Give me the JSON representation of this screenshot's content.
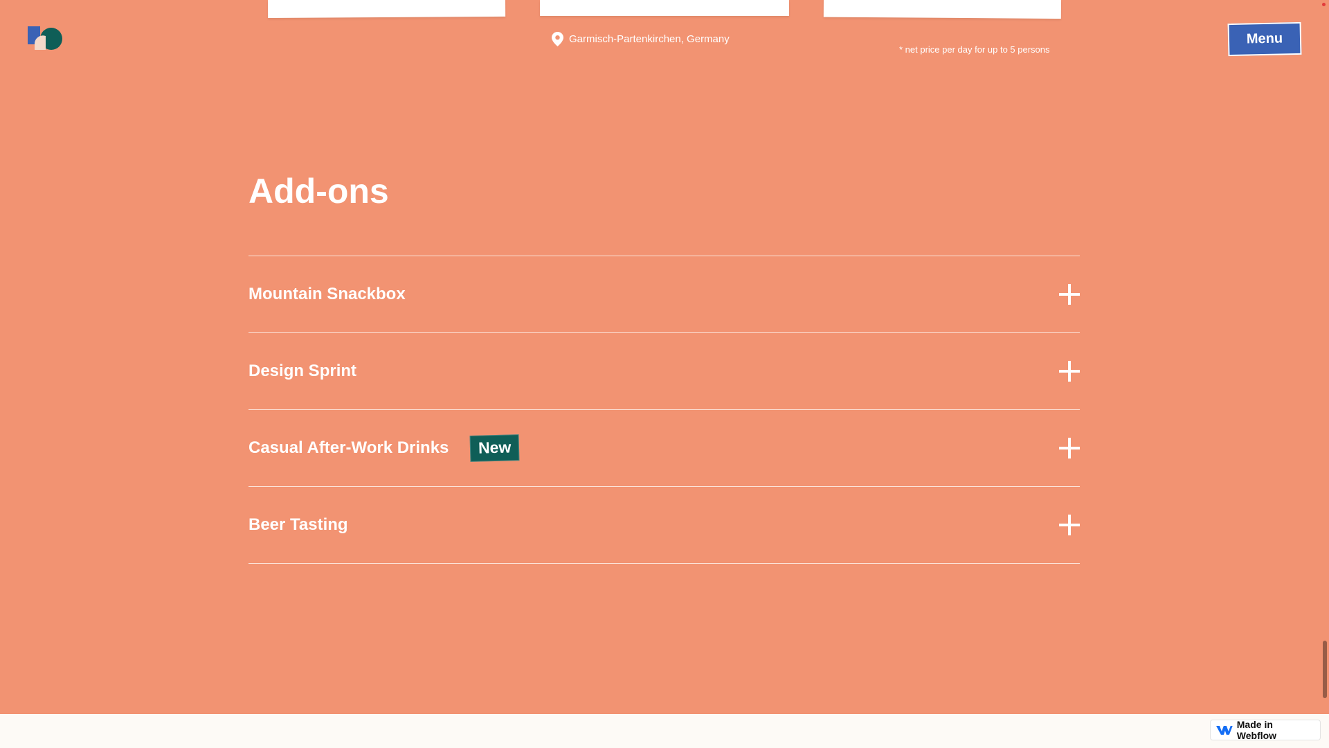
{
  "header": {
    "location": "Garmisch-Partenkirchen, Germany",
    "price_note": "* net price per day for up to 5 persons",
    "menu_label": "Menu"
  },
  "section": {
    "title": "Add-ons"
  },
  "addons": [
    {
      "title": "Mountain Snackbox",
      "badge": ""
    },
    {
      "title": "Design Sprint",
      "badge": ""
    },
    {
      "title": "Casual After-Work Drinks",
      "badge": "New"
    },
    {
      "title": "Beer Tasting",
      "badge": ""
    }
  ],
  "footer": {
    "webflow_badge": "Made in Webflow"
  },
  "colors": {
    "background": "#f29372",
    "menu_button": "#3a62b5",
    "new_badge": "#0f5e57",
    "bottom_bar": "#fdfaf6"
  },
  "icons": {
    "logo": "brand-logo",
    "location": "map-pin-icon",
    "expand": "plus-icon",
    "webflow": "webflow-icon"
  }
}
